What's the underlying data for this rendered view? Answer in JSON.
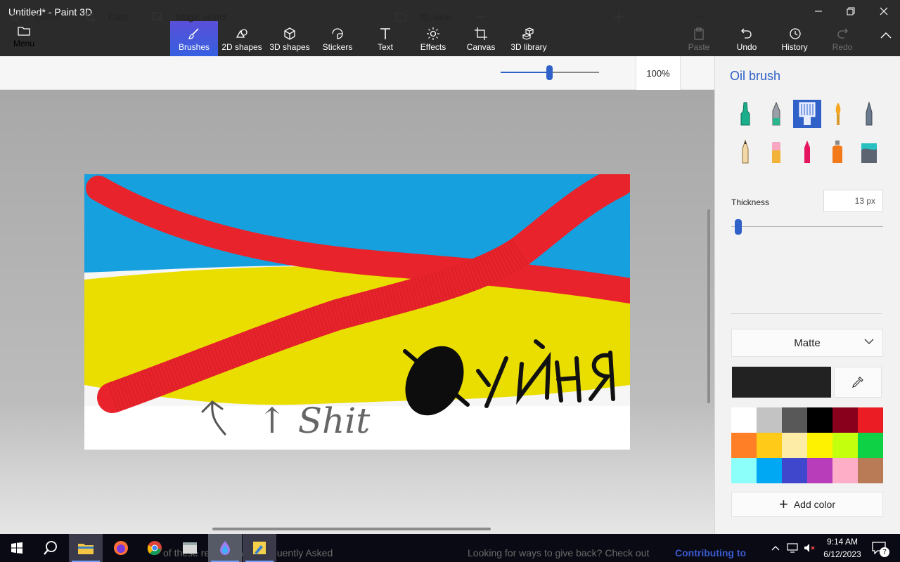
{
  "window": {
    "title": "Untitled* - Paint 3D",
    "minimize_icon": "minimize-icon",
    "maximize_icon": "restore-icon",
    "close_icon": "close-icon"
  },
  "ribbon": {
    "menu_label": "Menu",
    "tools": [
      {
        "label": "Brushes",
        "icon": "brush-icon",
        "active": true
      },
      {
        "label": "2D shapes",
        "icon": "2d-shapes-icon"
      },
      {
        "label": "3D shapes",
        "icon": "3d-cube-icon"
      },
      {
        "label": "Stickers",
        "icon": "sticker-icon"
      },
      {
        "label": "Text",
        "icon": "text-icon"
      },
      {
        "label": "Effects",
        "icon": "sun-icon"
      },
      {
        "label": "Canvas",
        "icon": "canvas-crop-icon"
      },
      {
        "label": "3D library",
        "icon": "3d-library-icon"
      }
    ],
    "actions": [
      {
        "label": "Paste",
        "enabled": false
      },
      {
        "label": "Undo",
        "enabled": true
      },
      {
        "label": "History",
        "enabled": true
      },
      {
        "label": "Redo",
        "enabled": false
      }
    ]
  },
  "cmdbar": {
    "select_label": "Select",
    "crop_label": "Crop",
    "magic_select_label": "Magic select",
    "view3d_label": "3D view",
    "zoom_value": 50,
    "zoom_percent": "100%",
    "more_label": "···"
  },
  "canvas": {
    "handwriting_text": "↑ Shit",
    "cyrillic_text": "Хуйня"
  },
  "panel": {
    "title": "Oil brush",
    "brushes_row1": [
      "marker",
      "calligraphy-pen",
      "oil-brush",
      "watercolor",
      "pixel-pen"
    ],
    "brushes_row2": [
      "pencil",
      "eraser",
      "crayon",
      "spray-can",
      "fill-bucket"
    ],
    "selected_brush": "oil-brush",
    "thickness_label": "Thickness",
    "thickness_value": "13 px",
    "thickness_fraction": 0.04,
    "finish_label": "Matte",
    "current_color": "#222222",
    "add_color_label": "Add color",
    "swatches": [
      "#ffffff",
      "#c3c3c3",
      "#585858",
      "#000000",
      "#88001b",
      "#ec1c24",
      "#ff7f27",
      "#ffca18",
      "#fdeca6",
      "#fff200",
      "#c4ff0e",
      "#0ed145",
      "#8cfffb",
      "#00a8f3",
      "#3f48cc",
      "#b83dba",
      "#ffaec8",
      "#b97a56"
    ]
  },
  "taskbar": {
    "bg_text_left": "of these resou... with Frequently Asked",
    "bg_text_right_1": "Looking for ways to give back? Check out",
    "bg_text_right_2": "Contributing to",
    "time": "9:14 AM",
    "date": "6/12/2023",
    "notifications": "7"
  }
}
